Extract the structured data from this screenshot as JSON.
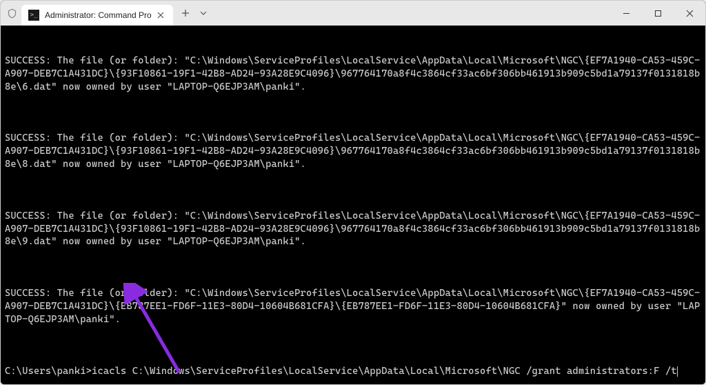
{
  "window": {
    "title": "Administrator: Command Pro",
    "tab_icon_text": ">_"
  },
  "terminal": {
    "blocks": [
      "SUCCESS: The file (or folder): \"C:\\Windows\\ServiceProfiles\\LocalService\\AppData\\Local\\Microsoft\\NGC\\{EF7A1940-CA53-459C-A907-DEB7C1A431DC}\\{93F10861-19F1-42B8-AD24-93A28E9C4096}\\967764170a8f4c3864cf33ac6bf306bb461913b909c5bd1a79137f0131818b8e\\6.dat\" now owned by user \"LAPTOP-Q6EJP3AM\\panki\".",
      "SUCCESS: The file (or folder): \"C:\\Windows\\ServiceProfiles\\LocalService\\AppData\\Local\\Microsoft\\NGC\\{EF7A1940-CA53-459C-A907-DEB7C1A431DC}\\{93F10861-19F1-42B8-AD24-93A28E9C4096}\\967764170a8f4c3864cf33ac6bf306bb461913b909c5bd1a79137f0131818b8e\\8.dat\" now owned by user \"LAPTOP-Q6EJP3AM\\panki\".",
      "SUCCESS: The file (or folder): \"C:\\Windows\\ServiceProfiles\\LocalService\\AppData\\Local\\Microsoft\\NGC\\{EF7A1940-CA53-459C-A907-DEB7C1A431DC}\\{93F10861-19F1-42B8-AD24-93A28E9C4096}\\967764170a8f4c3864cf33ac6bf306bb461913b909c5bd1a79137f0131818b8e\\9.dat\" now owned by user \"LAPTOP-Q6EJP3AM\\panki\".",
      "SUCCESS: The file (or folder): \"C:\\Windows\\ServiceProfiles\\LocalService\\AppData\\Local\\Microsoft\\NGC\\{EF7A1940-CA53-459C-A907-DEB7C1A431DC}\\{EB787EE1-FD6F-11E3-80D4-10604B681CFA}\\{EB787EE1-FD6F-11E3-80D4-10604B681CFA}\" now owned by user \"LAPTOP-Q6EJP3AM\\panki\"."
    ],
    "prompt": "C:\\Users\\panki>",
    "command": "icacls C:\\Windows\\ServiceProfiles\\LocalService\\AppData\\Local\\Microsoft\\NGC /grant administrators:F /t"
  },
  "annotation": {
    "color": "#8a2be2"
  }
}
